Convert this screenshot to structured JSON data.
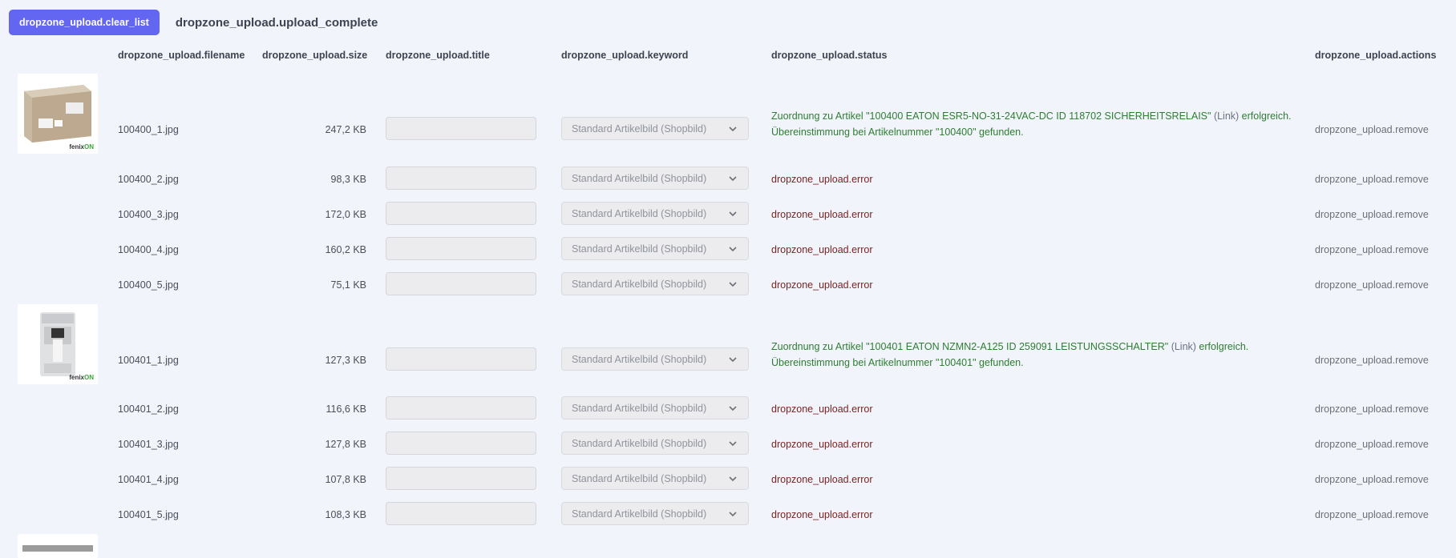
{
  "toolbar": {
    "clear_list_label": "dropzone_upload.clear_list",
    "upload_complete_label": "dropzone_upload.upload_complete"
  },
  "columns": {
    "filename": "dropzone_upload.filename",
    "size": "dropzone_upload.size",
    "title": "dropzone_upload.title",
    "keyword": "dropzone_upload.keyword",
    "status": "dropzone_upload.status",
    "actions": "dropzone_upload.actions"
  },
  "keyword_option": "Standard Artikelbild (Shopbild)",
  "remove_label": "dropzone_upload.remove",
  "error_label": "dropzone_upload.error",
  "groups": [
    {
      "brand": "fenix",
      "brand_on": "ON",
      "rows": [
        {
          "filename": "100400_1.jpg",
          "size": "247,2 KB",
          "status_line1_pre": "Zuordnung zu Artikel \"100400 EATON ESR5-NO-31-24VAC-DC ID 118702 SICHERHEITSRELAIS\" ",
          "status_link": "(Link)",
          "status_line1_post": " erfolgreich.",
          "status_line2": "Übereinstimmung bei Artikelnummer \"100400\" gefunden."
        },
        {
          "filename": "100400_2.jpg",
          "size": "98,3 KB"
        },
        {
          "filename": "100400_3.jpg",
          "size": "172,0 KB"
        },
        {
          "filename": "100400_4.jpg",
          "size": "160,2 KB"
        },
        {
          "filename": "100400_5.jpg",
          "size": "75,1 KB"
        }
      ]
    },
    {
      "brand": "fenix",
      "brand_on": "ON",
      "rows": [
        {
          "filename": "100401_1.jpg",
          "size": "127,3 KB",
          "status_line1_pre": "Zuordnung zu Artikel \"100401 EATON NZMN2-A125 ID 259091 LEISTUNGSSCHALTER\" ",
          "status_link": "(Link)",
          "status_line1_post": " erfolgreich.",
          "status_line2": "Übereinstimmung bei Artikelnummer \"100401\" gefunden."
        },
        {
          "filename": "100401_2.jpg",
          "size": "116,6 KB"
        },
        {
          "filename": "100401_3.jpg",
          "size": "127,8 KB"
        },
        {
          "filename": "100401_4.jpg",
          "size": "107,8 KB"
        },
        {
          "filename": "100401_5.jpg",
          "size": "108,3 KB"
        }
      ]
    }
  ]
}
